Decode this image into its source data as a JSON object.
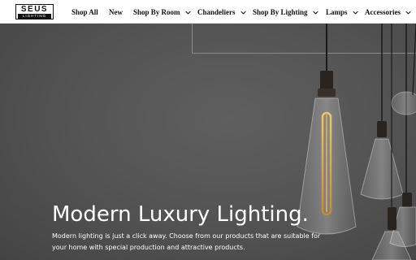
{
  "brand": {
    "name": "SEUS",
    "tagline": "LIGHTING"
  },
  "nav": {
    "items": [
      {
        "label": "Shop All",
        "has_menu": false
      },
      {
        "label": "New",
        "has_menu": false
      },
      {
        "label": "Shop By Room",
        "has_menu": true
      },
      {
        "label": "Chandeliers",
        "has_menu": true
      },
      {
        "label": "Shop By Lighting",
        "has_menu": true
      },
      {
        "label": "Lamps",
        "has_menu": true
      },
      {
        "label": "Accessories",
        "has_menu": true
      }
    ]
  },
  "hero": {
    "title": "Modern Luxury Lighting.",
    "description": "Modern lighting is just a click away. Choose from our products that are suitable for your home with special production and attractive products."
  },
  "colors": {
    "hero_bg": "#555555",
    "text_dark": "#111111",
    "bulb_filament": "#e8b34a"
  }
}
